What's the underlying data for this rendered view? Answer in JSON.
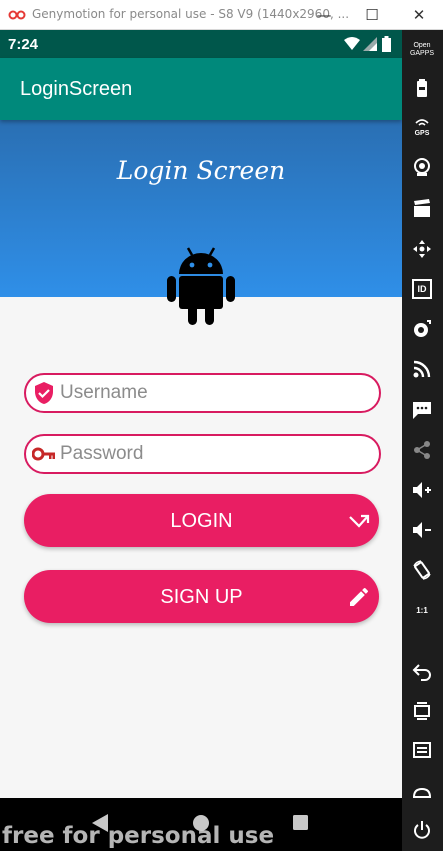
{
  "window": {
    "title": "Genymotion for personal use - S8 V9 (1440x2960, ...",
    "minimize_glyph": "—",
    "maximize_glyph": "☐",
    "close_glyph": "✕"
  },
  "status_bar": {
    "time": "7:24"
  },
  "app_bar": {
    "title": "LoginScreen"
  },
  "header": {
    "script_title": "Login Screen"
  },
  "form": {
    "username_placeholder": "Username",
    "username_value": "",
    "password_placeholder": "Password",
    "password_value": "",
    "login_label": "LOGIN",
    "signup_label": "SIGN UP"
  },
  "watermark": "free for personal use",
  "sidebar": {
    "open_gapps_label_line1": "Open",
    "open_gapps_label_line2": "GAPPS",
    "gps_label": "GPS",
    "id_label": "ID",
    "pixel_label": "1:1"
  },
  "colors": {
    "status_bar": "#00574b",
    "app_bar": "#00897b",
    "header_gradient_top": "#2a6fb3",
    "header_gradient_bottom": "#2f8fe8",
    "accent": "#e91e63",
    "field_border": "#d81b60",
    "sidebar": "#1d1d1d"
  },
  "icons": [
    "genymotion-logo-icon",
    "wifi-icon",
    "signal-icon",
    "battery-icon",
    "android-robot-icon",
    "shield-check-icon",
    "key-icon",
    "call-made-icon",
    "pencil-icon",
    "back-icon",
    "home-icon",
    "recents-icon",
    "open-gapps-icon",
    "battery-widget-icon",
    "gps-icon",
    "camera-icon",
    "clapperboard-icon",
    "dpad-icon",
    "id-icon",
    "capture-icon",
    "rss-icon",
    "sms-icon",
    "share-icon",
    "volume-up-icon",
    "volume-down-icon",
    "rotate-icon",
    "pixel-perfect-icon",
    "back-arrow-icon",
    "recent-apps-icon",
    "menu-icon",
    "home-outline-icon",
    "power-icon"
  ]
}
